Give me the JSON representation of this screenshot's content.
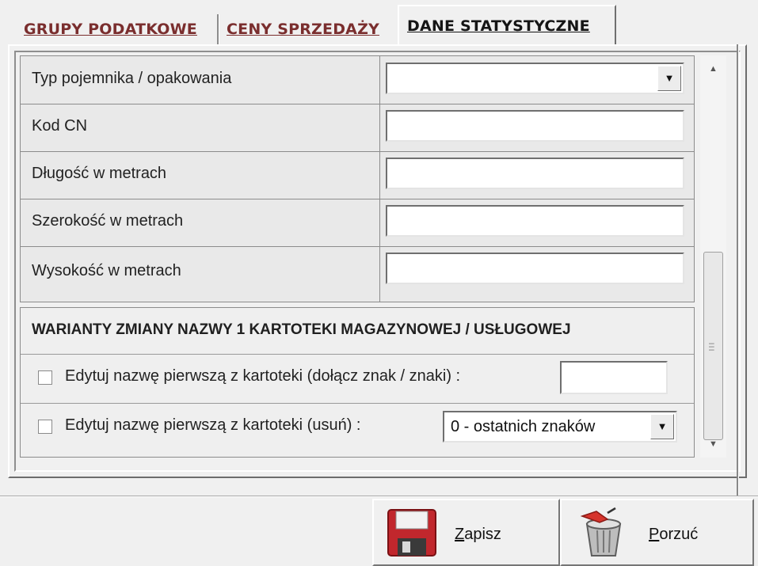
{
  "tabs": [
    {
      "label": "GRUPY PODATKOWE",
      "active": false
    },
    {
      "label": "CENY SPRZEDAŻY",
      "active": false
    },
    {
      "label": "DANE STATYSTYCZNE",
      "active": true
    }
  ],
  "fields": [
    {
      "label": "Typ pojemnika / opakowania",
      "type": "dropdown",
      "value": ""
    },
    {
      "label": "Kod CN",
      "type": "text",
      "value": ""
    },
    {
      "label": "Długość w metrach",
      "type": "text",
      "value": ""
    },
    {
      "label": "Szerokość w metrach",
      "type": "text",
      "value": ""
    },
    {
      "label": "Wysokość w metrach",
      "type": "text",
      "value": ""
    }
  ],
  "variants": {
    "title": "WARIANTY  ZMIANY NAZWY 1 KARTOTEKI MAGAZYNOWEJ / USŁUGOWEJ",
    "option1": {
      "label": "Edytuj nazwę pierwszą z kartoteki (dołącz znak / znaki)  :",
      "checked": false,
      "value": ""
    },
    "option2": {
      "label": "Edytuj nazwę pierwszą z kartoteki (usuń)  :",
      "checked": false,
      "selected": "0 - ostatnich znaków"
    }
  },
  "footer": {
    "save": {
      "mnemonic": "Z",
      "rest": "apisz",
      "icon": "floppy-disk-icon"
    },
    "discard": {
      "mnemonic": "P",
      "rest": "orzuć",
      "icon": "trash-bin-icon"
    }
  },
  "colors": {
    "tab_link": "#7a2e2e",
    "save_icon": "#c1272d",
    "discard_icon": "#b0b0b0"
  }
}
